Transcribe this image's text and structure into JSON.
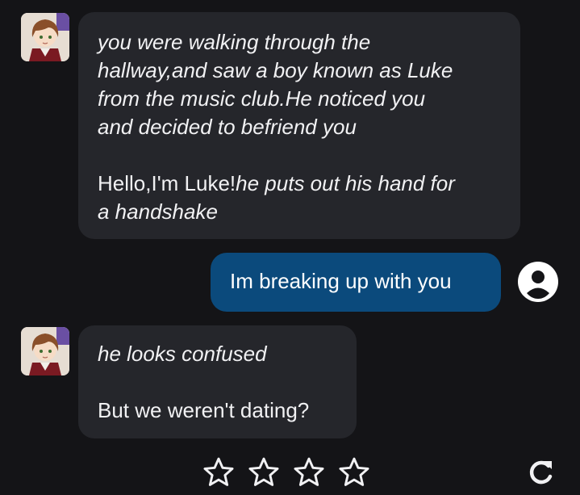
{
  "messages": [
    {
      "sender": "bot",
      "avatar_icon": "character-avatar-icon",
      "parts": [
        {
          "style": "italic",
          "text": "you were walking through the"
        },
        {
          "style": "italic",
          "text": "hallway,and saw a boy known as Luke"
        },
        {
          "style": "italic",
          "text": "from the music club.He noticed you"
        },
        {
          "style": "italic",
          "text": "and decided to befriend you"
        },
        {
          "style": "normal",
          "text": "Hello,I'm Luke!"
        },
        {
          "style": "italic",
          "text": "he puts out his hand for"
        },
        {
          "style": "italic",
          "text": "a handshake"
        }
      ]
    },
    {
      "sender": "user",
      "avatar_icon": "user-avatar-icon",
      "text": "Im breaking up with you"
    },
    {
      "sender": "bot",
      "avatar_icon": "character-avatar-icon",
      "parts": [
        {
          "style": "italic",
          "text": "he looks confused"
        },
        {
          "style": "normal",
          "text": "But we weren't dating?"
        }
      ]
    }
  ],
  "rating": {
    "max_stars": 5,
    "selected": 0,
    "icon": "star-outline-icon"
  },
  "actions": {
    "regenerate_icon": "refresh-icon"
  },
  "colors": {
    "background": "#141417",
    "bot_bubble": "#25262b",
    "user_bubble": "#0b4a7c",
    "text": "#f1f1f3"
  }
}
